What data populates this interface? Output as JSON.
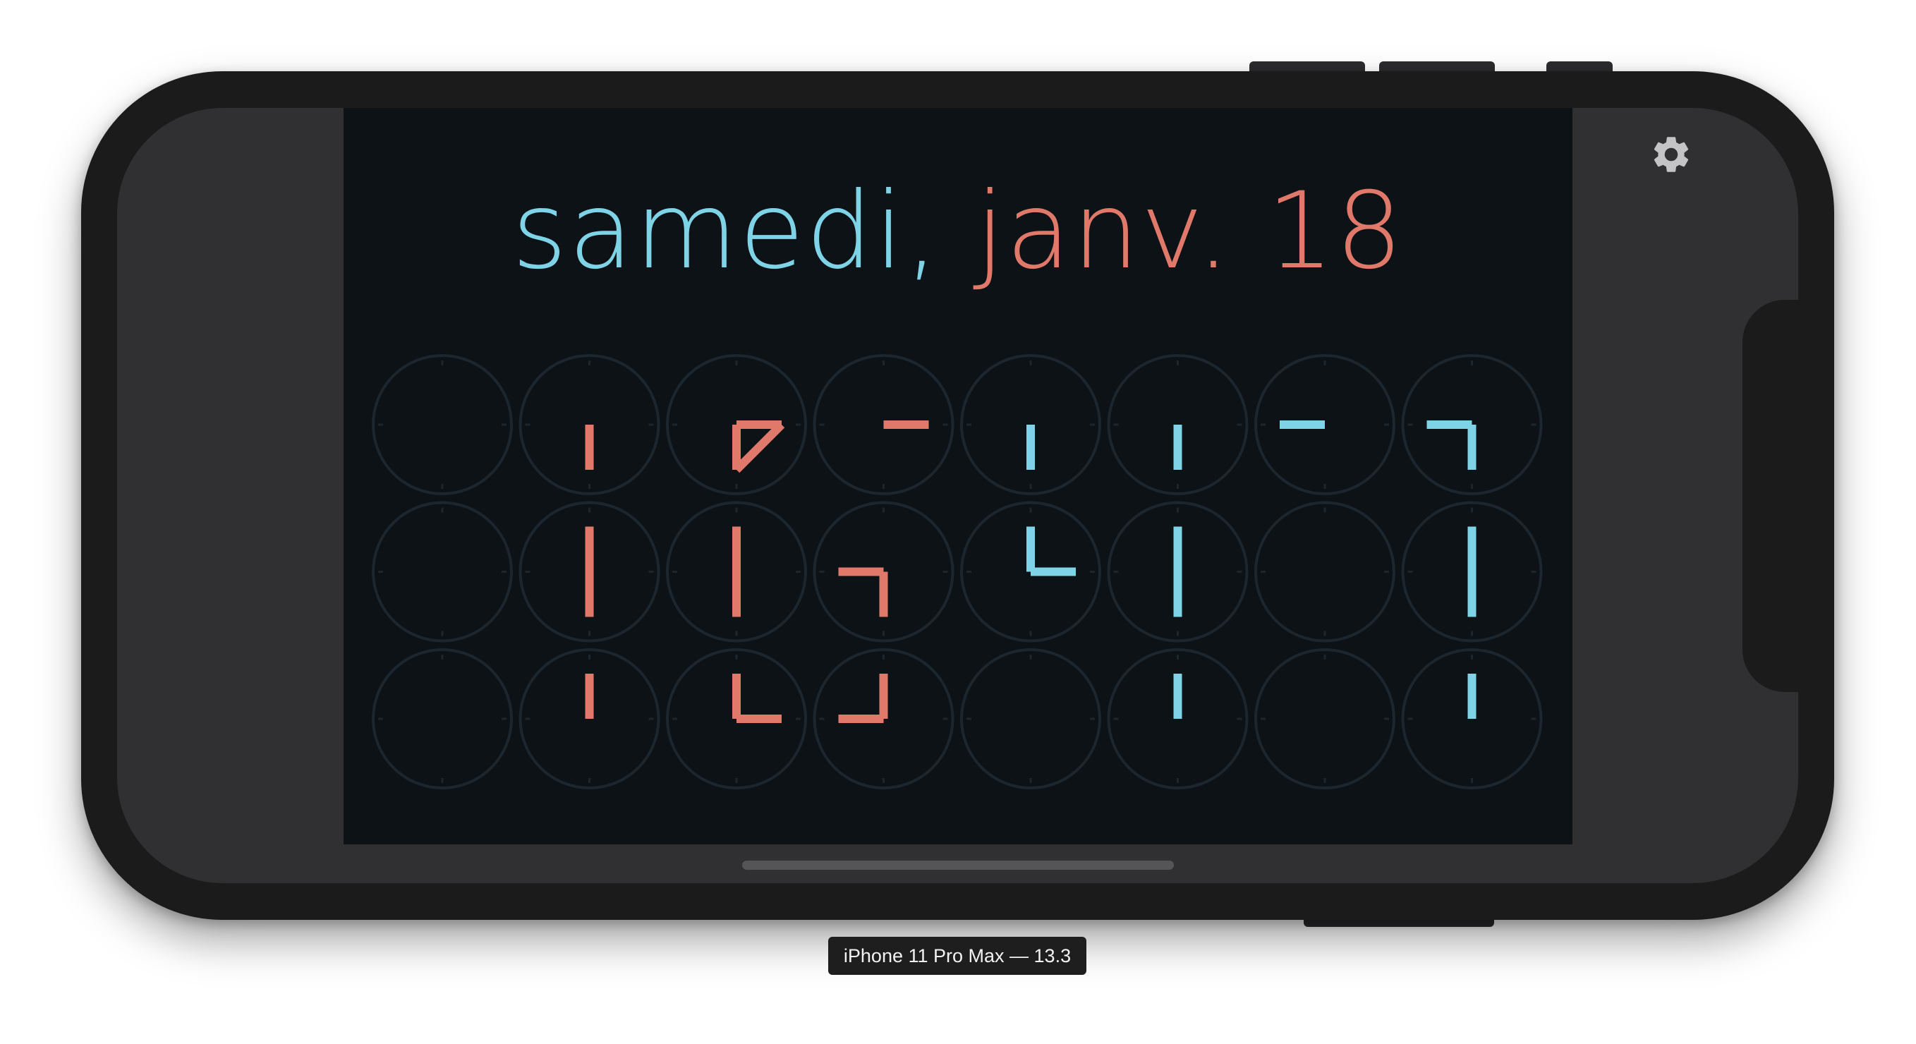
{
  "app": {
    "date_day": "samedi,",
    "date_rest": "janv. 18",
    "colors": {
      "background": "#0d1217",
      "accent_blue": "#7fd3e6",
      "accent_red": "#e0796a",
      "clock_ring": "#1d252d"
    },
    "grid": {
      "rows": 3,
      "columns": 8,
      "cells": [
        [
          [],
          [
            [
              "c",
              "s",
              "red"
            ]
          ],
          [
            [
              "e",
              "s",
              "red"
            ],
            [
              "c",
              "e",
              "red"
            ],
            [
              "c",
              "s",
              "red"
            ]
          ],
          [
            [
              "c",
              "e",
              "red"
            ]
          ],
          [
            [
              "c",
              "s",
              "blue"
            ]
          ],
          [
            [
              "c",
              "s",
              "blue"
            ]
          ],
          [
            [
              "w",
              "c",
              "blue"
            ]
          ],
          [
            [
              "w",
              "c",
              "blue"
            ],
            [
              "c",
              "s",
              "blue"
            ]
          ]
        ],
        [
          [],
          [
            [
              "n",
              "s",
              "red"
            ]
          ],
          [
            [
              "n",
              "s",
              "red"
            ]
          ],
          [
            [
              "w",
              "c",
              "red"
            ],
            [
              "c",
              "s",
              "red"
            ]
          ],
          [
            [
              "n",
              "c",
              "blue"
            ],
            [
              "c",
              "e",
              "blue"
            ]
          ],
          [
            [
              "n",
              "s",
              "blue"
            ]
          ],
          [],
          [
            [
              "n",
              "s",
              "blue"
            ]
          ]
        ],
        [
          [],
          [
            [
              "n",
              "c",
              "red"
            ]
          ],
          [
            [
              "n",
              "c",
              "red"
            ],
            [
              "c",
              "e",
              "red"
            ]
          ],
          [
            [
              "n",
              "c",
              "red"
            ],
            [
              "w",
              "c",
              "red"
            ]
          ],
          [],
          [
            [
              "n",
              "c",
              "blue"
            ]
          ],
          [],
          [
            [
              "n",
              "c",
              "blue"
            ]
          ]
        ]
      ]
    }
  },
  "settings_icon": "gear-icon",
  "device_label": "iPhone 11 Pro Max — 13.3"
}
